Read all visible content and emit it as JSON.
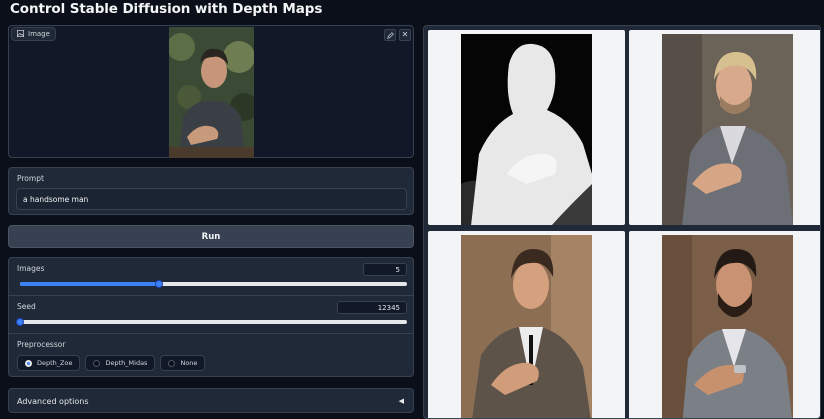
{
  "page": {
    "title": "Control Stable Diffusion with Depth Maps"
  },
  "image_input": {
    "label": "Image",
    "edit_icon": "pencil-icon",
    "close_icon": "close-icon",
    "close_glyph": "✕"
  },
  "prompt": {
    "label": "Prompt",
    "value": "a handsome man"
  },
  "run": {
    "label": "Run"
  },
  "images": {
    "label": "Images",
    "value": "5",
    "fraction": 0.36
  },
  "seed": {
    "label": "Seed",
    "value": "12345",
    "fraction": 0.0
  },
  "preprocessor": {
    "label": "Preprocessor",
    "options": [
      "Depth_Zoe",
      "Depth_Midas",
      "None"
    ],
    "selected": "Depth_Zoe"
  },
  "advanced": {
    "label": "Advanced options",
    "caret": "◀"
  },
  "colors": {
    "accent": "#3b82f6",
    "panel": "#1f2937",
    "background": "#0b0f19"
  }
}
